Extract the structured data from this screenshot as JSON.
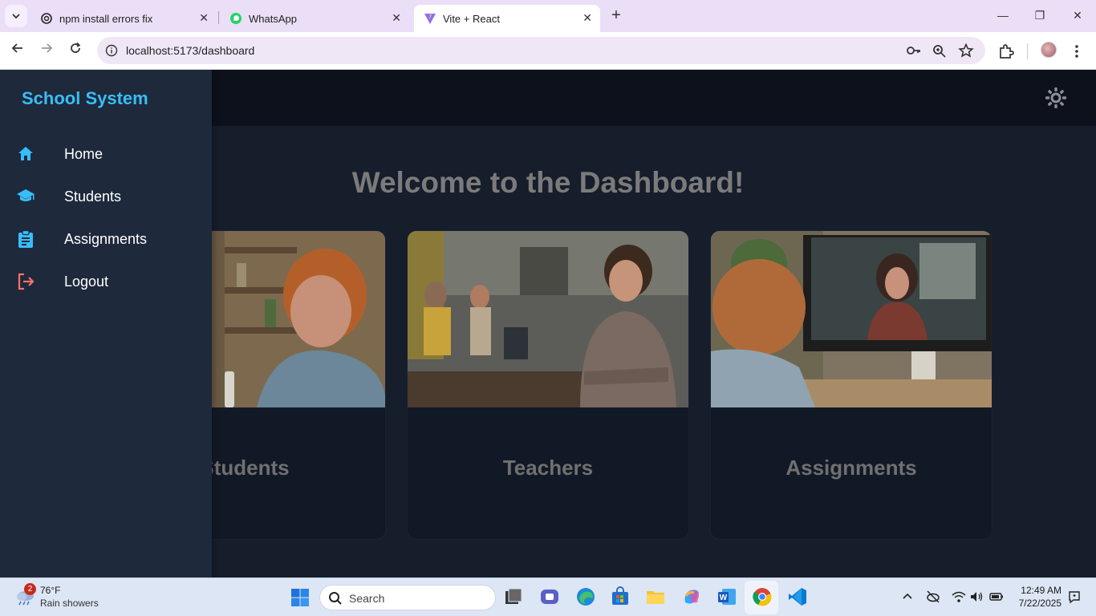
{
  "browser": {
    "tabs": [
      {
        "title": "npm install errors fix",
        "active": false
      },
      {
        "title": "WhatsApp",
        "active": false
      },
      {
        "title": "Vite + React",
        "active": true
      }
    ],
    "url": "localhost:5173/dashboard"
  },
  "app": {
    "brand": "School System",
    "nav": [
      {
        "label": "Home",
        "icon": "home-icon"
      },
      {
        "label": "Students",
        "icon": "graduation-cap-icon"
      },
      {
        "label": "Assignments",
        "icon": "clipboard-icon"
      },
      {
        "label": "Logout",
        "icon": "logout-icon"
      }
    ],
    "welcome": "Welcome to the Dashboard!",
    "cards": [
      {
        "label": "Students",
        "image": "boy-studying-photo"
      },
      {
        "label": "Teachers",
        "image": "teacher-portrait-photo"
      },
      {
        "label": "Assignments",
        "image": "video-call-photo"
      }
    ],
    "colors": {
      "accent": "#38bdf8",
      "sidebar": "#1e293b",
      "logout": "#f87171"
    }
  },
  "taskbar": {
    "weather": {
      "temp": "76°F",
      "condition": "Rain showers",
      "badge": "2"
    },
    "search_placeholder": "Search",
    "time": "12:49 AM",
    "date": "7/22/2025"
  }
}
